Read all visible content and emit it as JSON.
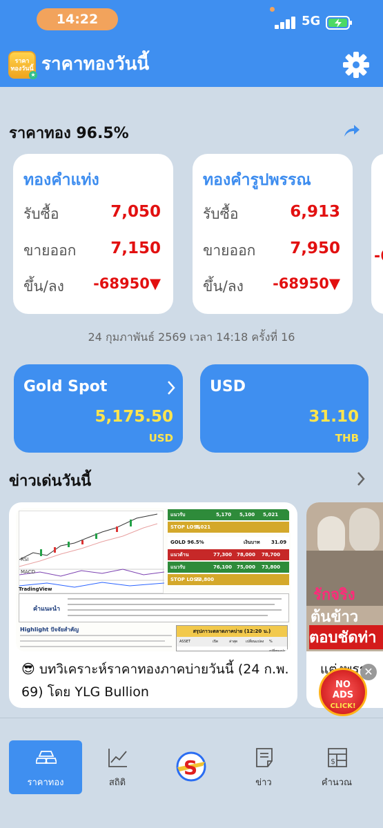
{
  "status_bar": {
    "time": "14:22",
    "network": "5G"
  },
  "app_bar": {
    "title": "ราคาทองวันนี้",
    "logo_text": "ราคาทองวันนี้"
  },
  "gold_section": {
    "title": "ราคาทอง 96.5%",
    "cards": [
      {
        "title": "ทองคำแท่ง",
        "buy_label": "รับซื้อ",
        "buy": "7,050",
        "sell_label": "ขายออก",
        "sell": "7,150",
        "change_label": "ขึ้น/ลง",
        "change": "-68950▼"
      },
      {
        "title": "ทองคำรูปพรรณ",
        "buy_label": "รับซื้อ",
        "buy": "6,913",
        "sell_label": "ขายออก",
        "sell": "7,950",
        "change_label": "ขึ้น/ลง",
        "change": "-68950▼"
      }
    ],
    "third_card_partial": "-6",
    "update_text": "24 กุมภาพันธ์ 2569 เวลา 14:18 ครั้งที่ 16"
  },
  "spot": {
    "gold": {
      "title": "Gold Spot",
      "value": "5,175.50",
      "unit": "USD"
    },
    "usd": {
      "title": "USD",
      "value": "31.10",
      "unit": "THB"
    }
  },
  "news": {
    "title": "ข่าวเด่นวันนี้",
    "items": [
      {
        "caption": "😎 บทวิเคราะห์ราคาทองภาคบ่ายวันนี้ (24 ก.พ. 69) โดย YLG Bullion",
        "thumb": {
          "table_rows": [
            {
              "label": "แนวรับ",
              "v1": "5,170",
              "v2": "5,100",
              "v3": "5,021"
            },
            {
              "label": "STOP LOSS",
              "v1": "5,021",
              "v2": "",
              "v3": ""
            },
            {
              "label": "GOLD 96.5%",
              "v1": "",
              "v2": "เงินบาท",
              "v3": "31.09"
            },
            {
              "label": "แนวต้าน",
              "v1": "77,300",
              "v2": "78,000",
              "v3": "78,700"
            },
            {
              "label": "แนวรับ",
              "v1": "76,100",
              "v2": "75,000",
              "v3": "73,800"
            },
            {
              "label": "STOP LOSS",
              "v1": "73,800",
              "v2": "",
              "v3": ""
            }
          ],
          "chart_labels": {
            "rsi": "RSI",
            "macd": "MACD",
            "brand": "TradingView"
          },
          "advice_title": "คำแนะนำ",
          "highlight_title": "Highlight ปัจจัยสำคัญ",
          "summary_title": "สรุปภาวะตลาดภาคบ่าย (12:20 น.)",
          "summary_headers": [
            "ASSET",
            "เปิด",
            "ล่าสุด",
            "เปลี่ยนแปลง",
            "% เปลี่ยนแปลง"
          ]
        }
      },
      {
        "overlay_lines": [
          "รักจริง",
          "ต้นข้าว",
          "ตอบชัดท่า"
        ],
        "caption": "แต่งพรร"
      }
    ]
  },
  "ad": {
    "text_top": "NO",
    "text_mid": "ADS",
    "text_bottom": "CLICK!"
  },
  "tabs": [
    {
      "label": "ราคาทอง",
      "icon": "gold-bars-icon",
      "active": true
    },
    {
      "label": "สถิติ",
      "icon": "chart-line-icon",
      "active": false
    },
    {
      "label": "ข่าว",
      "icon": "news-icon",
      "active": false
    },
    {
      "label": "คำนวณ",
      "icon": "calculator-icon",
      "active": false
    }
  ],
  "colors": {
    "primary": "#3f8ff0",
    "background": "#cfdbe7",
    "price_red": "#e21010",
    "value_yellow": "#ffe54d",
    "title_blue": "#3e8def"
  }
}
